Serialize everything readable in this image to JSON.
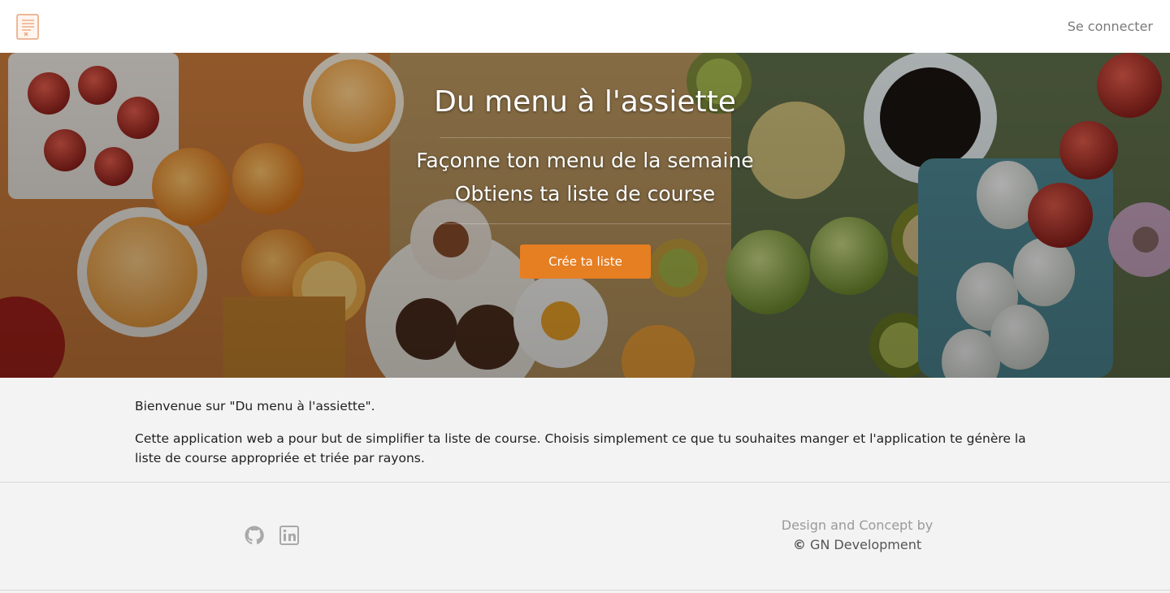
{
  "header": {
    "logo_alt": "Du menu à l'assiette",
    "login_label": "Se connecter"
  },
  "hero": {
    "title": "Du menu à l'assiette",
    "subtitle_line1": "Façonne ton menu de la semaine",
    "subtitle_line2": "Obtiens ta liste de course",
    "cta_label": "Crée ta liste"
  },
  "intro": {
    "welcome": "Bienvenue sur \"Du menu à l'assiette\".",
    "description": "Cette application web a pour but de simplifier ta liste de course. Choisis simplement ce que tu souhaites manger et l'application te génère la liste de course appropriée et triée par rayons."
  },
  "footer": {
    "social": [
      {
        "icon": "github-icon"
      },
      {
        "icon": "linkedin-icon"
      }
    ],
    "credits_line1": "Design and Concept by",
    "credits_copyright_symbol": "©",
    "credits_company": "GN Development"
  },
  "colors": {
    "accent": "#e67e22",
    "nav_bg": "#ffffff",
    "page_bg": "#f3f3f3",
    "muted_text": "#7a7a7a"
  }
}
